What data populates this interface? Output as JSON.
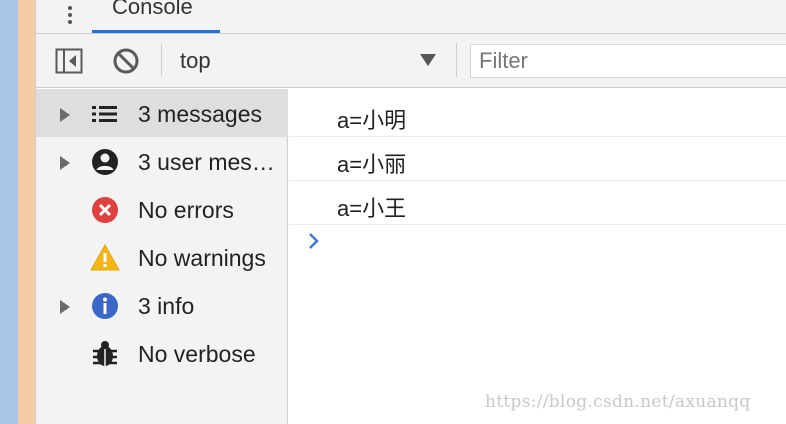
{
  "colors": {
    "accent": "#1a73e8",
    "error": "#e04040",
    "warning": "#f2b619",
    "info": "#3a67c8",
    "prompt": "#3b7bdb"
  },
  "tabs": [
    {
      "label": "Console",
      "active": true
    }
  ],
  "toolbar": {
    "context_value": "top",
    "filter_placeholder": "Filter",
    "filter_value": ""
  },
  "sidebar": {
    "items": [
      {
        "label": "3 messages",
        "icon": "list-icon",
        "expandable": true,
        "selected": true
      },
      {
        "label": "3 user messages",
        "icon": "user-icon",
        "expandable": true,
        "selected": false
      },
      {
        "label": "No errors",
        "icon": "error-icon",
        "expandable": false,
        "selected": false
      },
      {
        "label": "No warnings",
        "icon": "warning-icon",
        "expandable": false,
        "selected": false
      },
      {
        "label": "3 info",
        "icon": "info-icon",
        "expandable": true,
        "selected": false
      },
      {
        "label": "No verbose",
        "icon": "bug-icon",
        "expandable": false,
        "selected": false
      }
    ]
  },
  "console": {
    "messages": [
      {
        "text": "a=小明"
      },
      {
        "text": "a=小丽"
      },
      {
        "text": "a=小王"
      }
    ]
  },
  "watermark": "https://blog.csdn.net/axuanqq"
}
